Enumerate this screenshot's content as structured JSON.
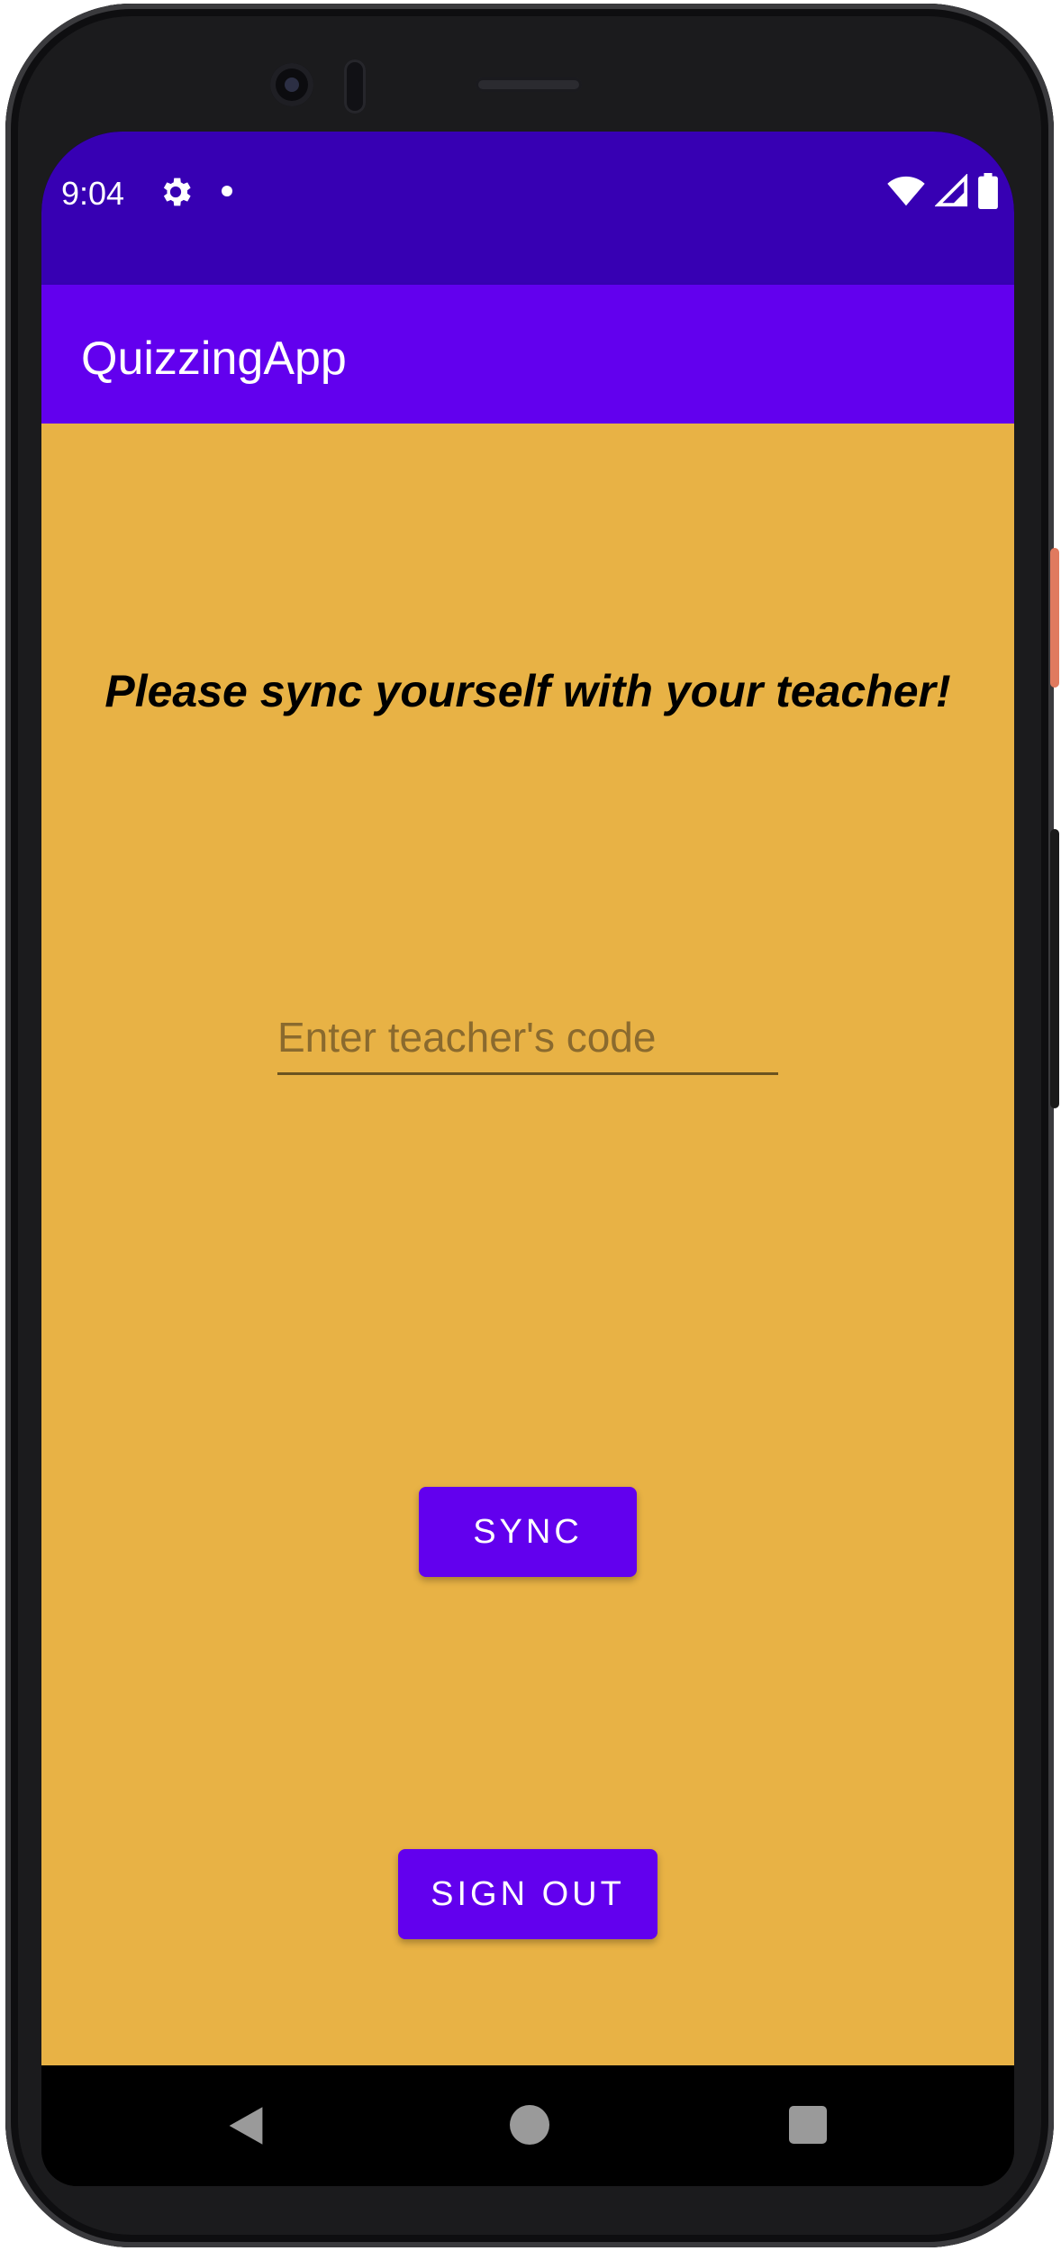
{
  "status_bar": {
    "time": "9:04",
    "icons": [
      "gear-icon",
      "notification-dot",
      "wifi-icon",
      "signal-icon",
      "battery-icon"
    ]
  },
  "app_bar": {
    "title": "QuizzingApp"
  },
  "main": {
    "headline": "Please sync yourself with your teacher!",
    "code_input": {
      "placeholder": "Enter teacher's code",
      "value": ""
    },
    "sync_button_label": "SYNC",
    "sign_out_button_label": "SIGN OUT"
  },
  "nav_bar": {
    "icons": [
      "back-icon",
      "home-icon",
      "recents-icon"
    ]
  },
  "colors": {
    "status_bar": "#3700b3",
    "app_bar": "#6200ee",
    "background": "#e8b245",
    "button": "#6200ee"
  }
}
